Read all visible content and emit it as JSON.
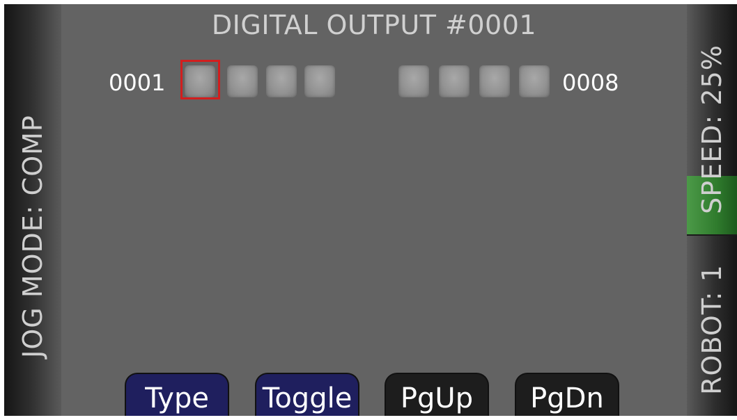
{
  "title": "DIGITAL OUTPUT #0001",
  "status": {
    "jog_mode": "JOG MODE: COMP",
    "speed": "SPEED: 25%",
    "robot": "ROBOT: 1"
  },
  "outputs": {
    "first_label": "0001",
    "last_label": "0008",
    "selected_index": 1,
    "states": [
      "off",
      "off",
      "off",
      "off",
      "off",
      "off",
      "off",
      "off"
    ]
  },
  "softkeys": [
    {
      "label": "Type",
      "style": "active"
    },
    {
      "label": "Toggle",
      "style": "active"
    },
    {
      "label": "PgUp",
      "style": "inactive"
    },
    {
      "label": "PgDn",
      "style": "inactive"
    }
  ],
  "colors": {
    "background": "#636363",
    "speed_highlight": "#2f7b2d",
    "selection_border": "#d21e1e",
    "active_key": "#1f1f5e",
    "inactive_key": "#1d1d1d"
  }
}
